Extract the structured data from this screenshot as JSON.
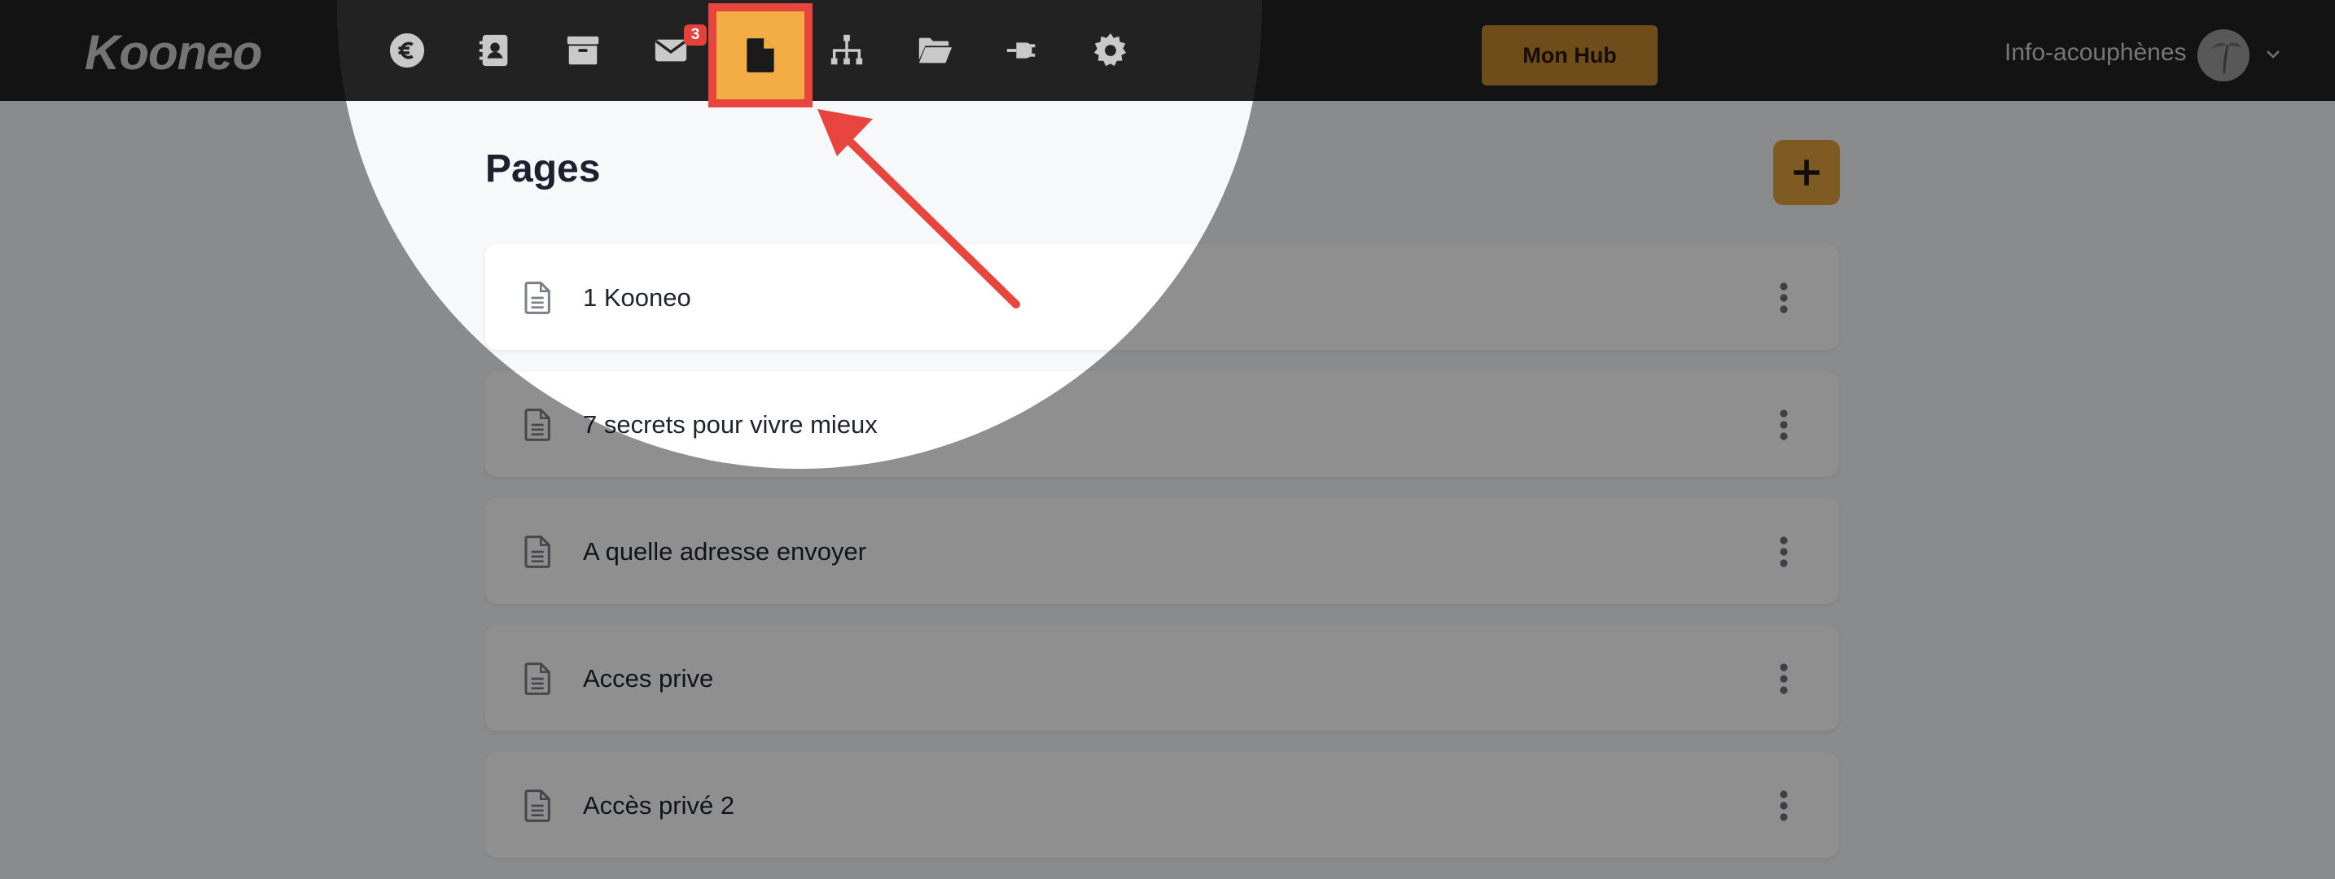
{
  "app": {
    "logo": "Kooneo"
  },
  "nav": {
    "items": [
      {
        "name": "sales-nav-icon",
        "icon": "euro-icon"
      },
      {
        "name": "contacts-nav-icon",
        "icon": "address-book-icon"
      },
      {
        "name": "products-nav-icon",
        "icon": "box-icon"
      },
      {
        "name": "mail-nav-icon",
        "icon": "envelope-icon",
        "badge": "3"
      },
      {
        "name": "pages-nav-icon",
        "icon": "file-icon",
        "active": true
      },
      {
        "name": "sitemap-nav-icon",
        "icon": "sitemap-icon"
      },
      {
        "name": "files-nav-icon",
        "icon": "folder-open-icon"
      },
      {
        "name": "integrations-nav-icon",
        "icon": "plug-icon"
      },
      {
        "name": "settings-nav-icon",
        "icon": "gear-icon"
      }
    ],
    "mail_badge": "3",
    "active_color": "#f4ad44",
    "highlight_color": "#e8453f"
  },
  "header": {
    "hub_label": "Mon Hub",
    "user_name": "Info-acouphènes"
  },
  "page": {
    "title": "Pages",
    "add_icon": "plus-icon",
    "items": [
      {
        "label": "1 Kooneo"
      },
      {
        "label": "7 secrets pour vivre mieux"
      },
      {
        "label": "A quelle adresse envoyer"
      },
      {
        "label": "Acces prive"
      },
      {
        "label": "Accès privé 2"
      }
    ]
  },
  "annotation": {
    "arrow_color": "#e8453f"
  }
}
